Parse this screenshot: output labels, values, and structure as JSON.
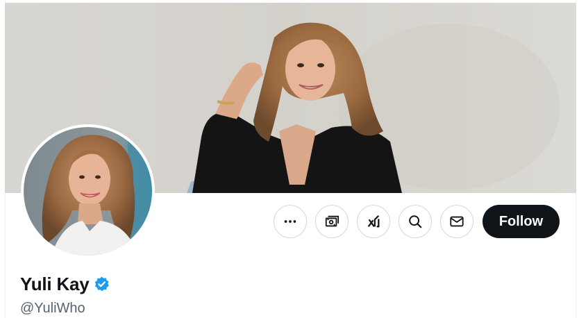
{
  "profile": {
    "display_name": "Yuli Kay",
    "handle": "@YuliWho",
    "verified": true
  },
  "actions": {
    "more": {
      "icon": "more-horizontal-icon"
    },
    "subscribe": {
      "icon": "money-icon"
    },
    "grok": {
      "icon": "grok-icon"
    },
    "search": {
      "icon": "search-icon"
    },
    "message": {
      "icon": "envelope-icon"
    },
    "follow_label": "Follow"
  },
  "colors": {
    "follow_bg": "#0f1419",
    "verified": "#1d9bf0",
    "handle": "#536471",
    "button_border": "#cfd9de"
  }
}
